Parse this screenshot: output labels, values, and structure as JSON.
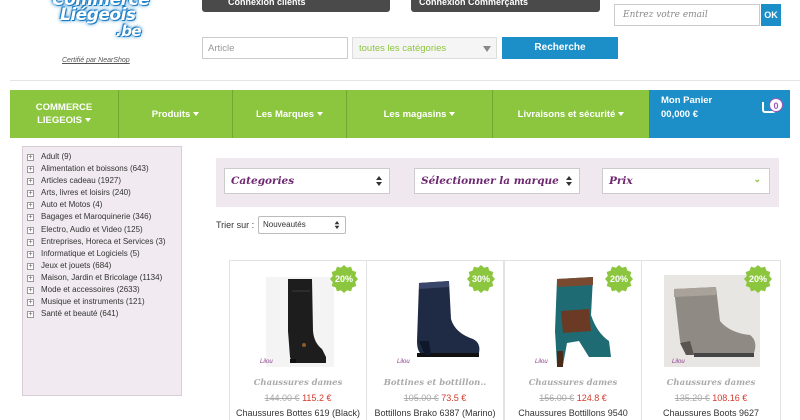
{
  "logo": {
    "line1": "Commerce",
    "line2": "Liégeois",
    "line3": ".be",
    "certified": "Certifié par NearShop"
  },
  "top_buttons": {
    "clients": "Connexion clients",
    "merchants": "Connexion Commerçants"
  },
  "newsletter": {
    "placeholder": "Entrez votre email",
    "ok_label": "OK"
  },
  "search": {
    "placeholder": "Article",
    "category_selected": "toutes les catégories",
    "button": "Recherche"
  },
  "nav": {
    "home_line1": "COMMERCE",
    "home_line2": "LIEGEOIS",
    "items": [
      "Produits",
      "Les Marques",
      "Les magasins",
      "Livraisons et sécurité"
    ],
    "cart_label": "Mon Panier",
    "cart_total": "00,000 €",
    "cart_count": "0"
  },
  "sidebar": {
    "categories": [
      "Adult (9)",
      "Alimentation et boissons (643)",
      "Articles cadeau (1927)",
      "Arts, livres et loisirs (240)",
      "Auto et Motos (4)",
      "Bagages et Maroquinerie (346)",
      "Electro, Audio et Video (125)",
      "Entreprises, Horeca et Services (3)",
      "Informatique et Logiciels (5)",
      "Jeux et jouets (684)",
      "Maison, Jardin et Bricolage (1134)",
      "Mode et accessoires (2633)",
      "Musique et instruments (121)",
      "Santé et beauté (641)"
    ]
  },
  "filters": {
    "categories": "Categories",
    "brand": "Sélectionner la marque",
    "price": "Prix"
  },
  "sort": {
    "label": "Trier sur :",
    "selected": "Nouveautés"
  },
  "products": [
    {
      "discount": "20%",
      "category": "Chaussures dames",
      "old_price": "144.00 €",
      "new_price": "115.2 €",
      "name": "Chaussures Bottes 619 (Black)",
      "brand_mark": "Lilou"
    },
    {
      "discount": "30%",
      "category": "Bottines et bottillon..",
      "old_price": "105.00 €",
      "new_price": "73.5 €",
      "name": "Bottillons Brako 6387 (Marino)",
      "brand_mark": "Lilou"
    },
    {
      "discount": "20%",
      "category": "Chaussures dames",
      "old_price": "156.00 €",
      "new_price": "124.8 €",
      "name": "Chaussures Bottillons 9540",
      "brand_mark": "Lilou"
    },
    {
      "discount": "20%",
      "category": "Chaussures dames",
      "old_price": "135.20 €",
      "new_price": "108.16 €",
      "name": "Chaussures Boots 9627",
      "brand_mark": "Lilou"
    }
  ],
  "colors": {
    "green": "#8cc63f",
    "blue": "#1c8ec8",
    "purple": "#6d2770",
    "sale_red": "#d23a2d"
  }
}
